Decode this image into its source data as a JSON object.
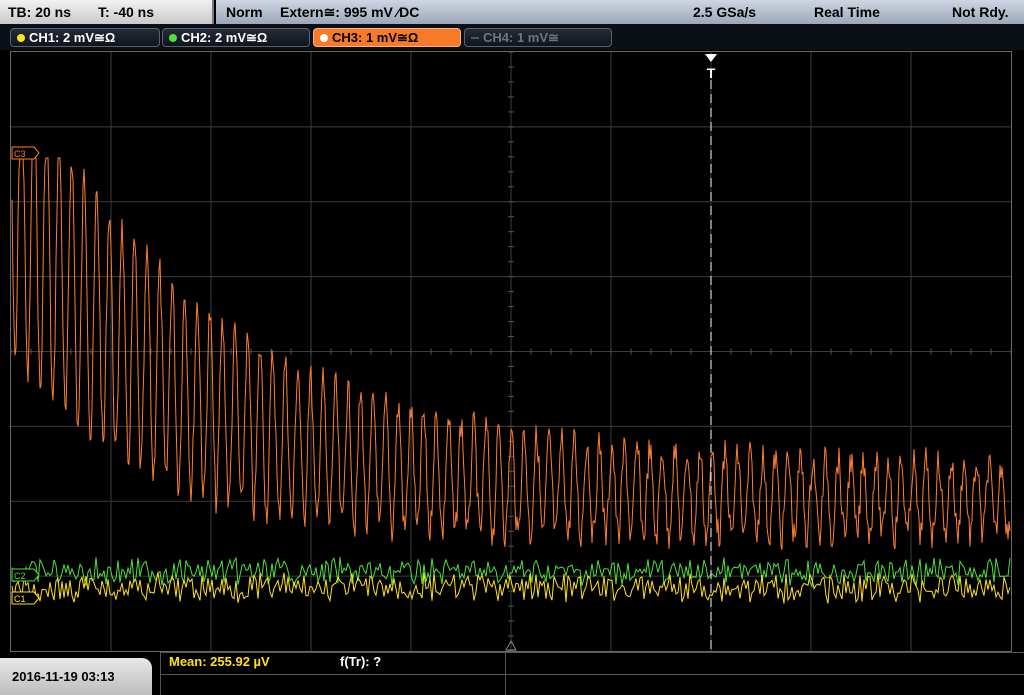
{
  "top_bar": {
    "timebase": "TB: 20 ns",
    "trigger_time": "T: -40 ns",
    "mode": "Norm",
    "trigger_source": "Extern≅: 995 mV ⁄DC",
    "sample_rate": "2.5 GSa/s",
    "acquisition": "Real Time",
    "state": "Not Rdy."
  },
  "channels": [
    {
      "label": "CH1: 2 mV≅Ω",
      "color": "#ffe11a",
      "active": false,
      "enabled": true
    },
    {
      "label": "CH2: 2 mV≅Ω",
      "color": "#4fe03a",
      "active": false,
      "enabled": true
    },
    {
      "label": "CH3: 1 mV≅Ω",
      "color": "#ff7f2a",
      "active": true,
      "enabled": true
    },
    {
      "label": "CH4: 1 mV≅",
      "color": "#777777",
      "active": false,
      "enabled": false
    }
  ],
  "markers": {
    "ch3": "C3",
    "ch2": "C2",
    "ch1": "C1",
    "trigger": "T"
  },
  "bottom_bar": {
    "datetime": "2016-11-19 03:13",
    "measurement_1": "Mean: 255.92 µV",
    "measurement_2": "f(Tr): ?"
  },
  "colors": {
    "ch1": "#ffe11a",
    "ch2": "#4fe03a",
    "ch3": "#ff7f2a",
    "grid": "#3c3c3c",
    "measurement_1": "#ffe11a"
  }
}
